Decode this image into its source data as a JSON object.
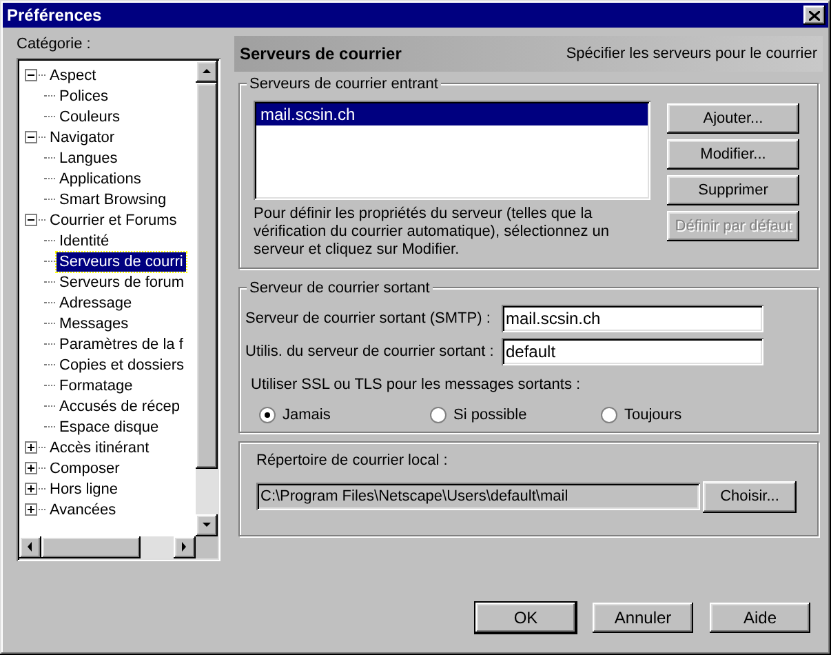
{
  "window": {
    "title": "Préférences"
  },
  "category_label": "Catégorie :",
  "tree": [
    {
      "label": "Aspect",
      "expanded": true,
      "selected": false,
      "children": [
        {
          "label": "Polices",
          "selected": false
        },
        {
          "label": "Couleurs",
          "selected": false
        }
      ]
    },
    {
      "label": "Navigator",
      "expanded": true,
      "selected": false,
      "children": [
        {
          "label": "Langues",
          "selected": false
        },
        {
          "label": "Applications",
          "selected": false
        },
        {
          "label": "Smart Browsing",
          "selected": false
        }
      ]
    },
    {
      "label": "Courrier et Forums",
      "expanded": true,
      "selected": false,
      "children": [
        {
          "label": "Identité",
          "selected": false
        },
        {
          "label": "Serveurs de courri",
          "selected": true
        },
        {
          "label": "Serveurs de forum",
          "selected": false
        },
        {
          "label": "Adressage",
          "selected": false
        },
        {
          "label": "Messages",
          "selected": false
        },
        {
          "label": "Paramètres de la f",
          "selected": false
        },
        {
          "label": "Copies et dossiers",
          "selected": false
        },
        {
          "label": "Formatage",
          "selected": false
        },
        {
          "label": "Accusés de récep",
          "selected": false
        },
        {
          "label": "Espace disque",
          "selected": false
        }
      ]
    },
    {
      "label": "Accès itinérant",
      "expanded": false,
      "selected": false
    },
    {
      "label": "Composer",
      "expanded": false,
      "selected": false
    },
    {
      "label": "Hors ligne",
      "expanded": false,
      "selected": false
    },
    {
      "label": "Avancées",
      "expanded": false,
      "selected": false
    }
  ],
  "panel": {
    "title": "Serveurs de courrier",
    "description": "Spécifier les serveurs pour le courrier"
  },
  "incoming": {
    "legend": "Serveurs de courrier entrant",
    "servers": [
      {
        "label": "mail.scsin.ch",
        "selected": true
      }
    ],
    "buttons": [
      {
        "label": "Ajouter...",
        "disabled": false
      },
      {
        "label": "Modifier...",
        "disabled": false
      },
      {
        "label": "Supprimer",
        "disabled": false
      },
      {
        "label": "Définir par défaut",
        "disabled": true
      }
    ],
    "help": "Pour définir les propriétés du serveur (telles que la vérification du courrier automatique), sélectionnez un serveur et cliquez sur Modifier."
  },
  "outgoing": {
    "legend": "Serveur de courrier sortant",
    "fields": [
      {
        "label": "Serveur de courrier sortant (SMTP) :",
        "value": "mail.scsin.ch"
      },
      {
        "label": "Utilis. du serveur de courrier sortant :",
        "value": "default"
      }
    ],
    "ssl_label": "Utiliser SSL ou TLS pour les messages sortants :",
    "ssl_options": [
      {
        "label": "Jamais",
        "selected": true
      },
      {
        "label": "Si possible",
        "selected": false
      },
      {
        "label": "Toujours",
        "selected": false
      }
    ]
  },
  "local": {
    "label": "Répertoire de courrier local :",
    "path": "C:\\Program Files\\Netscape\\Users\\default\\mail",
    "button": "Choisir..."
  },
  "footer_buttons": [
    {
      "label": "OK",
      "default": true
    },
    {
      "label": "Annuler",
      "default": false
    },
    {
      "label": "Aide",
      "default": false
    }
  ]
}
